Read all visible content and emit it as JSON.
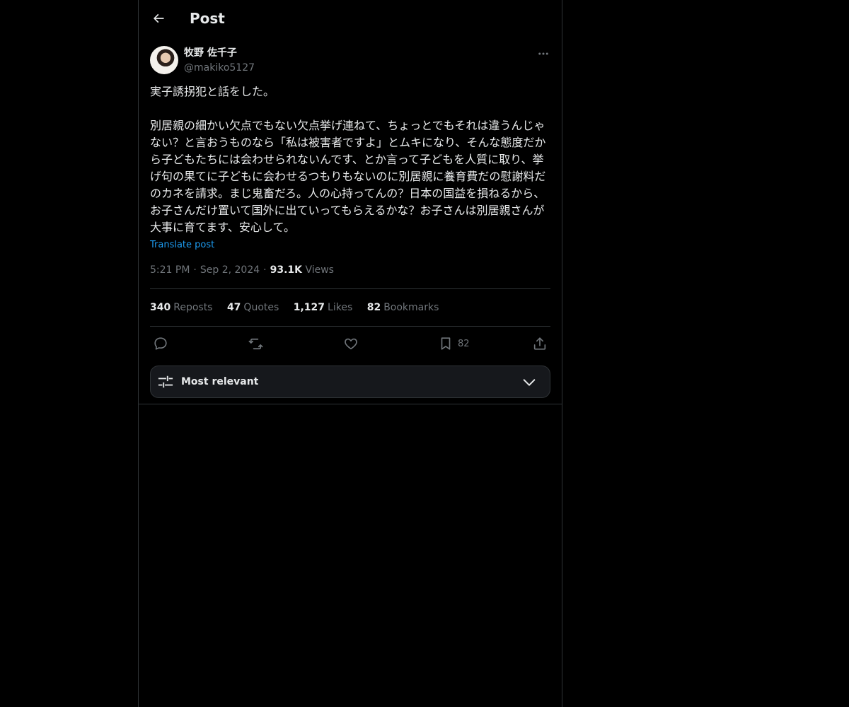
{
  "header": {
    "title": "Post"
  },
  "post": {
    "author_name": "牧野 佐千子",
    "author_handle": "@makiko5127",
    "text": "実子誘拐犯と話をした。\n\n別居親の細かい欠点でもない欠点挙げ連ねて、ちょっとでもそれは違うんじゃない？と言おうものなら「私は被害者ですよ」とムキになり、そんな態度だから子どもたちには会わせられないんです、とか言って子どもを人質に取り、挙げ句の果てに子どもに会わせるつもりもないのに別居親に養育費だの慰謝料だのカネを請求。まじ鬼畜だろ。人の心持ってんの？日本の国益を損ねるから、お子さんだけ置いて国外に出ていってもらえるかな？お子さんは別居親さんが大事に育てます、安心して。",
    "translate_label": "Translate post",
    "time": "5:21 PM",
    "date": "Sep 2, 2024",
    "views_count": "93.1K",
    "views_label": "Views"
  },
  "stats": {
    "reposts_count": "340",
    "reposts_label": "Reposts",
    "quotes_count": "47",
    "quotes_label": "Quotes",
    "likes_count": "1,127",
    "likes_label": "Likes",
    "bookmarks_count": "82",
    "bookmarks_label": "Bookmarks"
  },
  "actions": {
    "bookmark_count": "82",
    "icons": [
      "reply-icon",
      "repost-icon",
      "like-icon",
      "bookmark-icon",
      "share-icon"
    ]
  },
  "sort": {
    "label": "Most relevant"
  },
  "colors": {
    "background": "#000000",
    "text": "#e7e9ea",
    "muted": "#71767b",
    "link": "#1d9bf0",
    "border": "#2f3336"
  }
}
